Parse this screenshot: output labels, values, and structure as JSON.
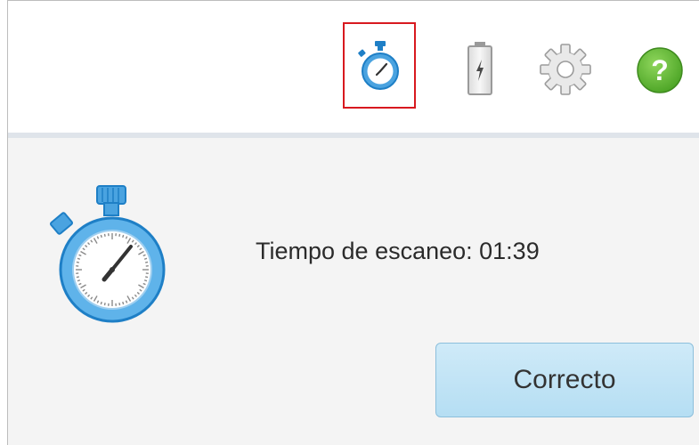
{
  "toolbar": {
    "icons": [
      {
        "name": "scan-timer-icon",
        "highlighted": true
      },
      {
        "name": "battery-icon",
        "highlighted": false
      },
      {
        "name": "settings-gear-icon",
        "highlighted": false
      },
      {
        "name": "help-icon",
        "highlighted": false
      }
    ],
    "help_glyph": "?",
    "highlight_color": "#d8191f"
  },
  "dialog": {
    "icon": "stopwatch-icon",
    "message": "Tiempo de escaneo: 01:39",
    "ok_label": "Correcto"
  },
  "colors": {
    "timer_blue": "#4aa3e0",
    "help_green": "#5cb82e",
    "button_fill": "#c2e4f6"
  }
}
